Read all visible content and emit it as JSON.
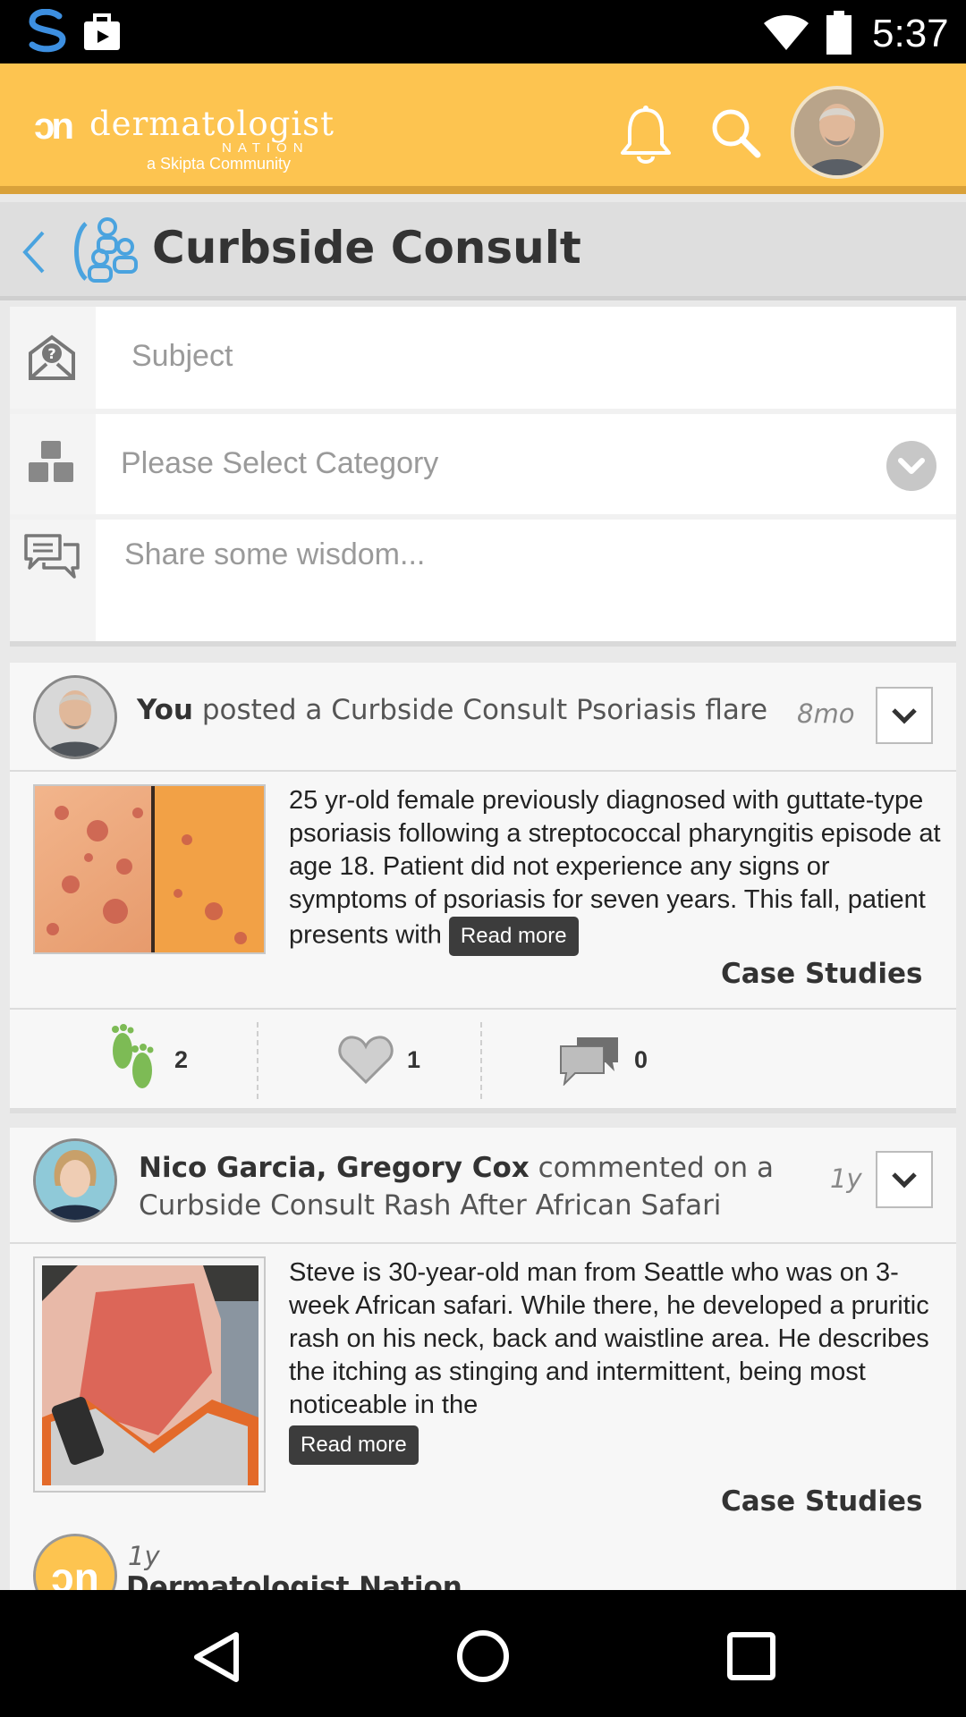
{
  "status_bar": {
    "time": "5:37"
  },
  "header": {
    "brand_mark": "ɔn",
    "brand_name": "dermatologist",
    "brand_nation": "NATION",
    "brand_sub": "a Skipta Community"
  },
  "section": {
    "title": "Curbside Consult"
  },
  "compose": {
    "subject_placeholder": "Subject",
    "category_placeholder": "Please Select Category",
    "message_placeholder": "Share some wisdom..."
  },
  "posts": [
    {
      "author": "You",
      "action": " posted a Curbside Consult Psoriasis flare",
      "time": "8mo",
      "body": "25 yr-old female previously diagnosed with guttate-type psoriasis following a streptococcal pharyngitis episode at age 18. Patient did not experience any signs or symptoms of psoriasis for seven years. This fall, patient presents with ",
      "read_more": "Read more",
      "category": "Case Studies",
      "footprints": "2",
      "likes": "1",
      "comments": "0"
    },
    {
      "author": "Nico Garcia, Gregory Cox",
      "action": "  commented on a Curbside Consult Rash After African Safari",
      "time": "1y",
      "body": "Steve is 30-year-old man from Seattle who was on 3-week African safari. While there, he developed a pruritic rash on his neck, back and waistline area. He describes the itching as stinging and intermittent, being most noticeable in the",
      "read_more": "Read more",
      "category": "Case Studies"
    },
    {
      "time": "1y",
      "author": "Dermatologist Nation"
    }
  ],
  "colors": {
    "header": "#fdc450",
    "accent": "#4aa3df",
    "green": "#7dbb55"
  }
}
